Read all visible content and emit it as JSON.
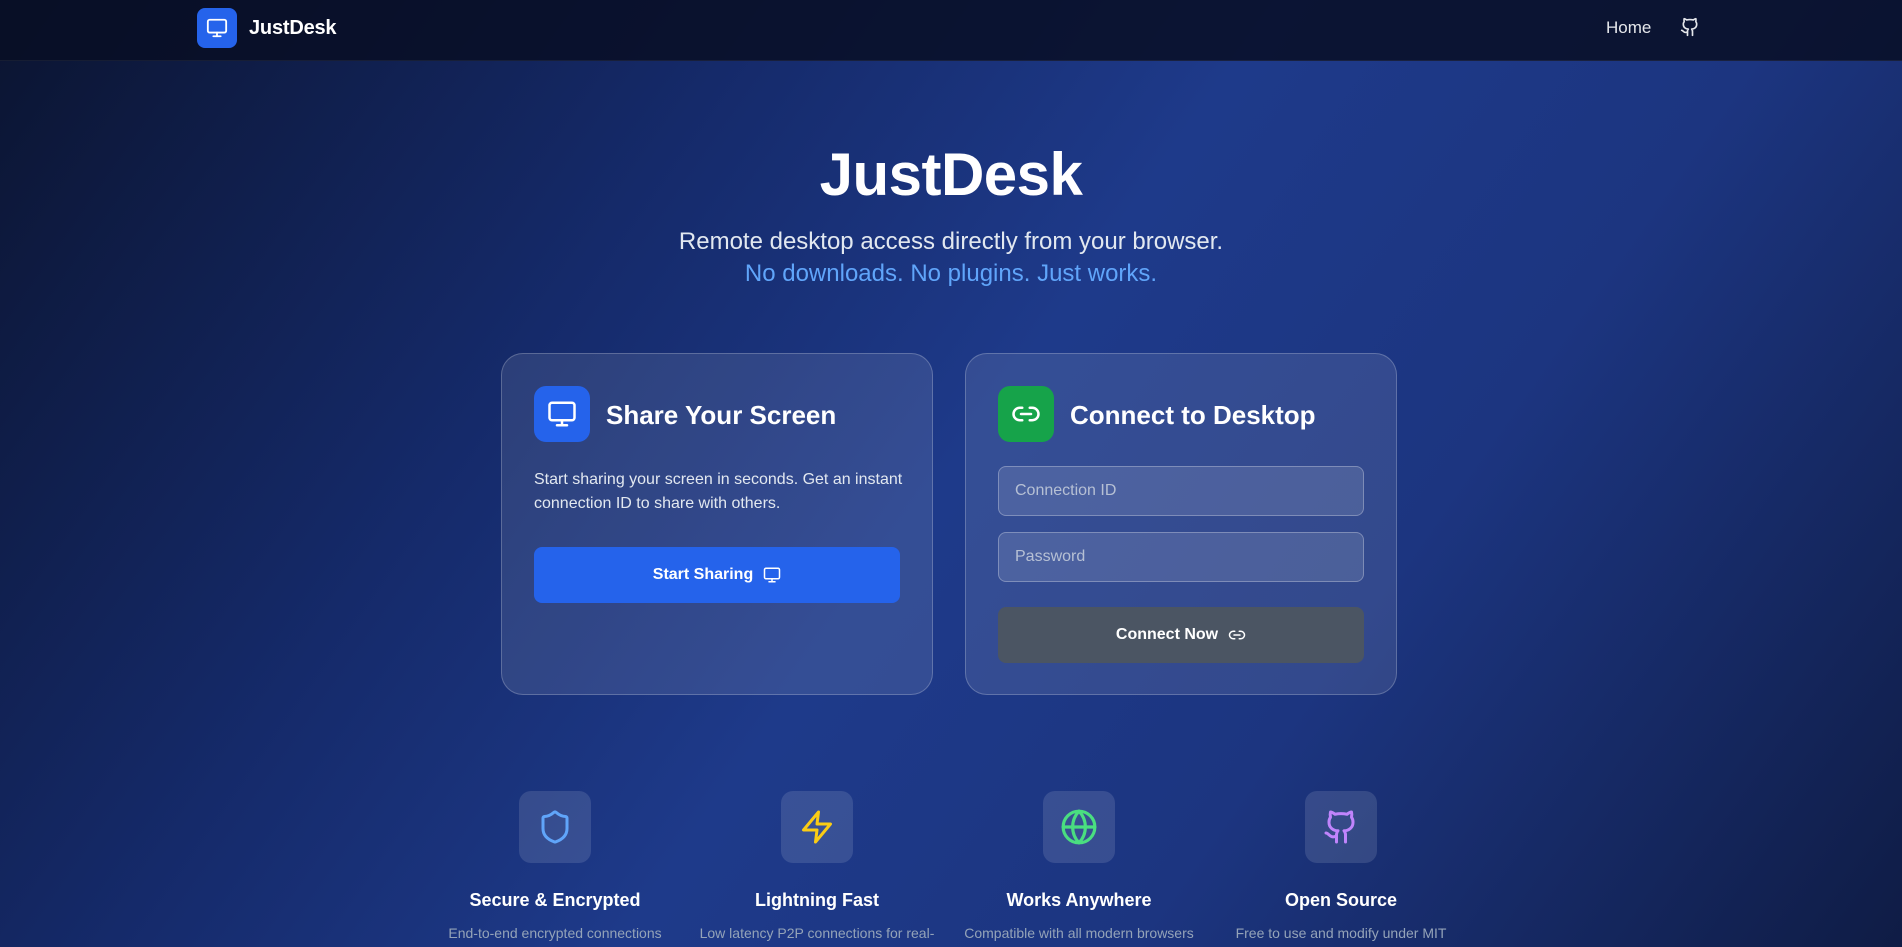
{
  "navbar": {
    "brand": "JustDesk",
    "links": {
      "home": "Home"
    },
    "icons": {
      "logo": "monitor-icon",
      "github": "github-icon"
    }
  },
  "hero": {
    "title": "JustDesk",
    "subtitle": "Remote desktop access directly from your browser.",
    "tagline": "No downloads. No plugins. Just works."
  },
  "share_card": {
    "title": "Share Your Screen",
    "description": "Start sharing your screen in seconds. Get an instant connection ID to share with others.",
    "button_label": "Start Sharing",
    "icon": "monitor-icon"
  },
  "connect_card": {
    "title": "Connect to Desktop",
    "connection_id_placeholder": "Connection ID",
    "password_placeholder": "Password",
    "button_label": "Connect Now",
    "icon": "link-icon"
  },
  "features": [
    {
      "title": "Secure & Encrypted",
      "description": "End-to-end encrypted connections",
      "icon": "shield-icon",
      "color": "#60a5fa"
    },
    {
      "title": "Lightning Fast",
      "description": "Low latency P2P connections for real-",
      "icon": "lightning-icon",
      "color": "#facc15"
    },
    {
      "title": "Works Anywhere",
      "description": "Compatible with all modern browsers",
      "icon": "globe-icon",
      "color": "#4ade80"
    },
    {
      "title": "Open Source",
      "description": "Free to use and modify under MIT",
      "icon": "github-icon",
      "color": "#c084fc"
    }
  ],
  "colors": {
    "primary": "#2563eb",
    "success": "#16a34a",
    "button_disabled": "#4b5563",
    "tagline": "#60a5fa"
  }
}
